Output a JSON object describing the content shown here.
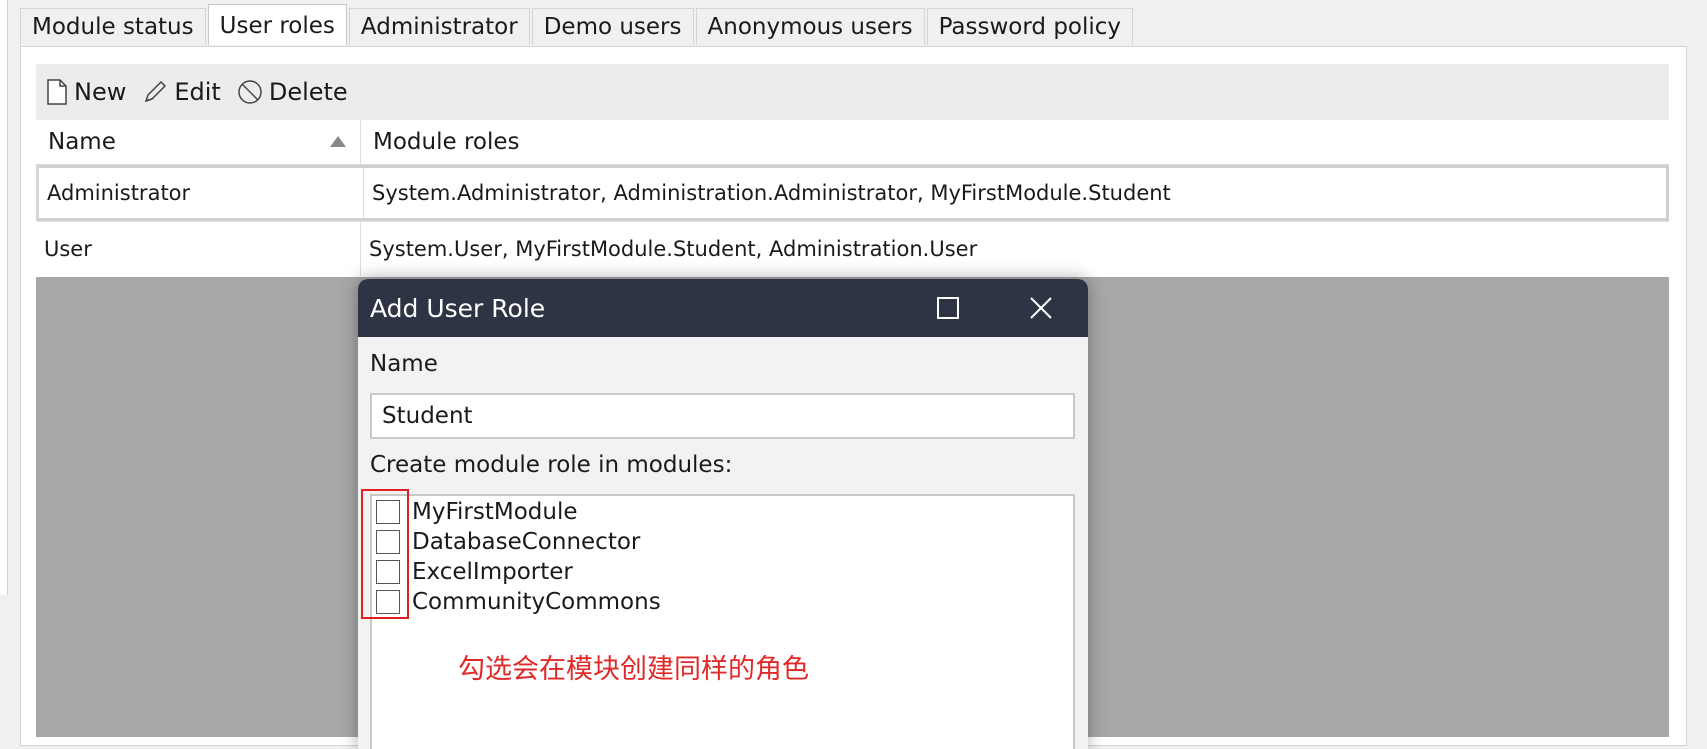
{
  "tabs": [
    "Module status",
    "User roles",
    "Administrator",
    "Demo users",
    "Anonymous users",
    "Password policy"
  ],
  "active_tab": "User roles",
  "toolbar": {
    "new_label": "New",
    "edit_label": "Edit",
    "delete_label": "Delete",
    "new_icon": "new-document-icon",
    "edit_icon": "pencil-icon",
    "delete_icon": "prohibited-icon"
  },
  "grid": {
    "columns": [
      "Name",
      "Module roles"
    ],
    "sort_icon": "sort-ascending-icon",
    "rows": [
      {
        "name": "Administrator",
        "module_roles": "System.Administrator, Administration.Administrator, MyFirstModule.Student"
      },
      {
        "name": "User",
        "module_roles": "System.User, MyFirstModule.Student, Administration.User"
      }
    ]
  },
  "dialog": {
    "title": "Add User Role",
    "maximize_icon": "maximize-icon",
    "close_icon": "close-icon",
    "name_label": "Name",
    "name_value": "Student",
    "modules_label": "Create module role in modules:",
    "modules": [
      "MyFirstModule",
      "DatabaseConnector",
      "ExcelImporter",
      "CommunityCommons"
    ],
    "annotation": "勾选会在模块创建同样的角色"
  },
  "colors": {
    "dialog_title_bg": "#2d3444",
    "annotation": "#e02a2a",
    "overlay": "#a8a8a8"
  }
}
